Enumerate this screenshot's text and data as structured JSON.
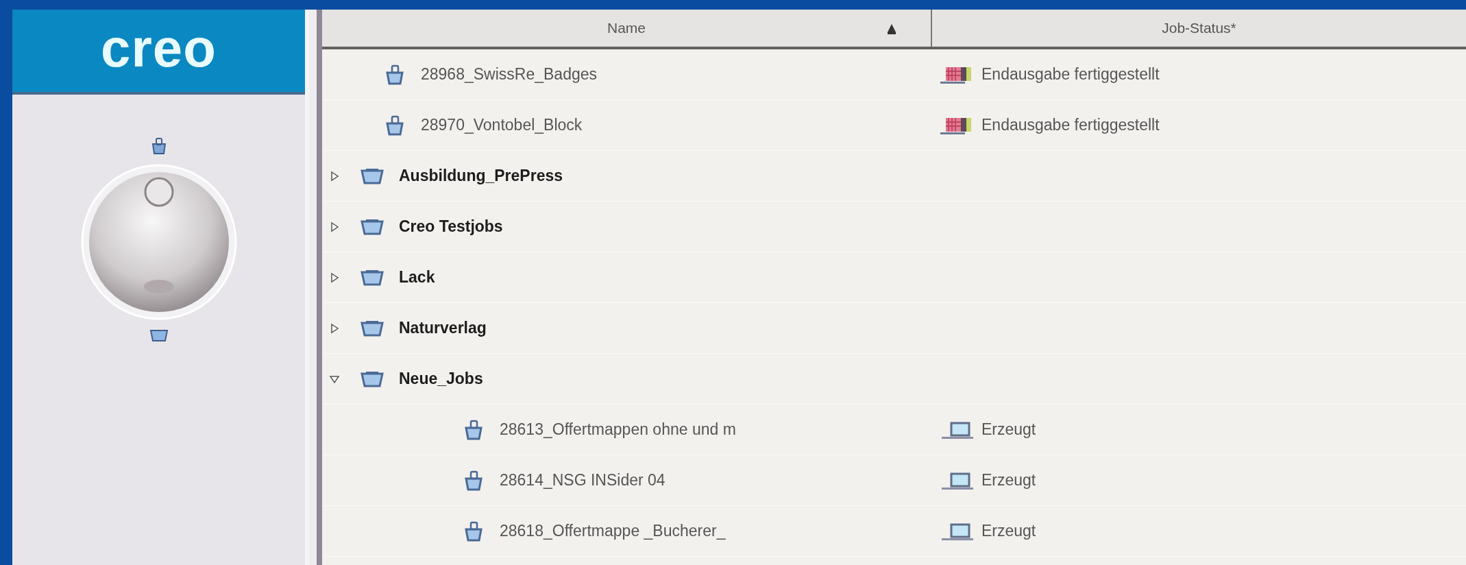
{
  "logo": "creo",
  "table": {
    "columns": [
      {
        "label": "Name",
        "sorted": true
      },
      {
        "label": "Job-Status*",
        "sorted": false
      }
    ],
    "rows": [
      {
        "kind": "job",
        "name": "28968_SwissRe_Badges",
        "status": {
          "kind": "output-done",
          "text": "Endausgabe fertiggestellt"
        }
      },
      {
        "kind": "job",
        "name": "28970_Vontobel_Block",
        "status": {
          "kind": "output-done",
          "text": "Endausgabe fertiggestellt"
        }
      },
      {
        "kind": "folder",
        "name": "Ausbildung_PrePress",
        "expanded": false
      },
      {
        "kind": "folder",
        "name": "Creo Testjobs",
        "expanded": false
      },
      {
        "kind": "folder",
        "name": "Lack",
        "expanded": false
      },
      {
        "kind": "folder",
        "name": "Naturverlag",
        "expanded": false
      },
      {
        "kind": "folder",
        "name": "Neue_Jobs",
        "expanded": true,
        "children": [
          {
            "kind": "job",
            "name": "28613_Offertmappen ohne und m",
            "status": {
              "kind": "created",
              "text": "Erzeugt"
            }
          },
          {
            "kind": "job",
            "name": "28614_NSG INSider 04",
            "status": {
              "kind": "created",
              "text": "Erzeugt"
            }
          },
          {
            "kind": "job",
            "name": "28618_Offertmappe _Bucherer_",
            "status": {
              "kind": "created",
              "text": "Erzeugt"
            }
          }
        ]
      }
    ]
  }
}
